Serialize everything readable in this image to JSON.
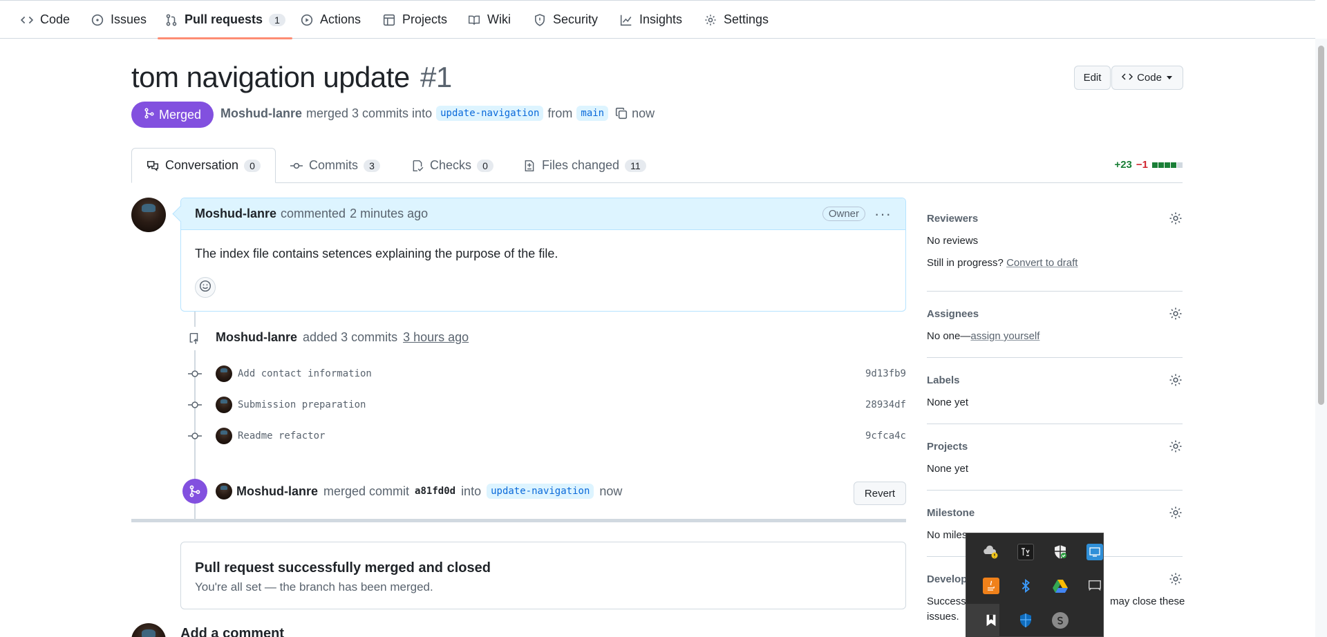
{
  "repo_nav": {
    "tabs": [
      {
        "label": "Code",
        "icon": "code-icon"
      },
      {
        "label": "Issues",
        "icon": "issue-icon"
      },
      {
        "label": "Pull requests",
        "icon": "pull-request-icon",
        "count": "1",
        "active": true
      },
      {
        "label": "Actions",
        "icon": "play-icon"
      },
      {
        "label": "Projects",
        "icon": "table-icon"
      },
      {
        "label": "Wiki",
        "icon": "book-icon"
      },
      {
        "label": "Security",
        "icon": "shield-icon"
      },
      {
        "label": "Insights",
        "icon": "graph-icon"
      },
      {
        "label": "Settings",
        "icon": "gear-icon"
      }
    ]
  },
  "header": {
    "title": "tom navigation update",
    "number": "#1",
    "edit_label": "Edit",
    "code_label": "Code",
    "state_label": "Merged",
    "author": "Moshud-lanre",
    "merged_text": "merged 3 commits into",
    "base_branch": "update-navigation",
    "from_text": "from",
    "head_branch": "main",
    "time": "now"
  },
  "pr_tabs": [
    {
      "label": "Conversation",
      "count": "0",
      "icon": "comment-discussion-icon"
    },
    {
      "label": "Commits",
      "count": "3",
      "icon": "git-commit-icon"
    },
    {
      "label": "Checks",
      "count": "0",
      "icon": "checklist-icon"
    },
    {
      "label": "Files changed",
      "count": "11",
      "icon": "file-diff-icon"
    }
  ],
  "diffstat": {
    "additions": "+23",
    "deletions": "−1"
  },
  "comment": {
    "author": "Moshud-lanre",
    "action": "commented",
    "time": "2 minutes ago",
    "role": "Owner",
    "body": "The index file contains setences explaining the purpose of the file."
  },
  "commits_event": {
    "author": "Moshud-lanre",
    "action": "added 3 commits",
    "time": "3 hours ago",
    "commits": [
      {
        "message": "Add contact information",
        "sha": "9d13fb9"
      },
      {
        "message": "Submission preparation",
        "sha": "28934df"
      },
      {
        "message": "Readme refactor",
        "sha": "9cfca4c"
      }
    ]
  },
  "merge_event": {
    "author": "Moshud-lanre",
    "action": "merged commit",
    "sha": "a81fd0d",
    "into": "into",
    "branch": "update-navigation",
    "time": "now",
    "revert_label": "Revert"
  },
  "merged_box": {
    "title": "Pull request successfully merged and closed",
    "subtitle": "You're all set — the branch has been merged."
  },
  "add_comment_label": "Add a comment",
  "sidebar": {
    "reviewers": {
      "title": "Reviewers",
      "value": "No reviews",
      "draft_prefix": "Still in progress?",
      "draft_link": "Convert to draft"
    },
    "assignees": {
      "title": "Assignees",
      "value_prefix": "No one—",
      "value_link": "assign yourself"
    },
    "labels": {
      "title": "Labels",
      "value": "None yet"
    },
    "projects": {
      "title": "Projects",
      "value": "None yet"
    },
    "milestone": {
      "title": "Milestone",
      "value": "No miles"
    },
    "development": {
      "title": "Develop",
      "value_line1_start": "Successf",
      "value_line1_end": "may close these",
      "value_line2": "issues."
    }
  },
  "tray": {
    "icons": [
      "onedrive-warning-icon",
      "app-icon",
      "shield-check-icon",
      "monitor-app-icon",
      "java-icon",
      "bluetooth-icon",
      "google-drive-icon",
      "display-icon",
      "bookmark-icon",
      "defender-icon",
      "skype-icon"
    ]
  }
}
